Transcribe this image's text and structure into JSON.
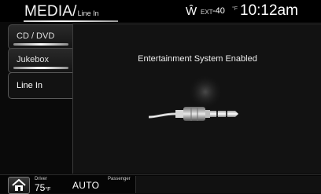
{
  "header": {
    "title": "MEDIA/",
    "subtitle": "Line In",
    "compass_icon": "compass-w-icon",
    "compass_glyph": "Ŵ",
    "ext_label": "EXT",
    "ext_temp": "-40",
    "ext_unit": "°F",
    "clock": "10:12am"
  },
  "tabs": [
    {
      "label": "CD / DVD",
      "active": false
    },
    {
      "label": "Jukebox",
      "active": false
    },
    {
      "label": "Line In",
      "active": true
    }
  ],
  "main": {
    "status_text": "Entertainment System Enabled",
    "illustration": "audio-jack-icon"
  },
  "footer": {
    "home_icon": "home-icon",
    "driver_label": "Driver",
    "driver_temp": "75",
    "driver_unit": "°F",
    "mode": "AUTO",
    "passenger_label": "Passenger"
  }
}
